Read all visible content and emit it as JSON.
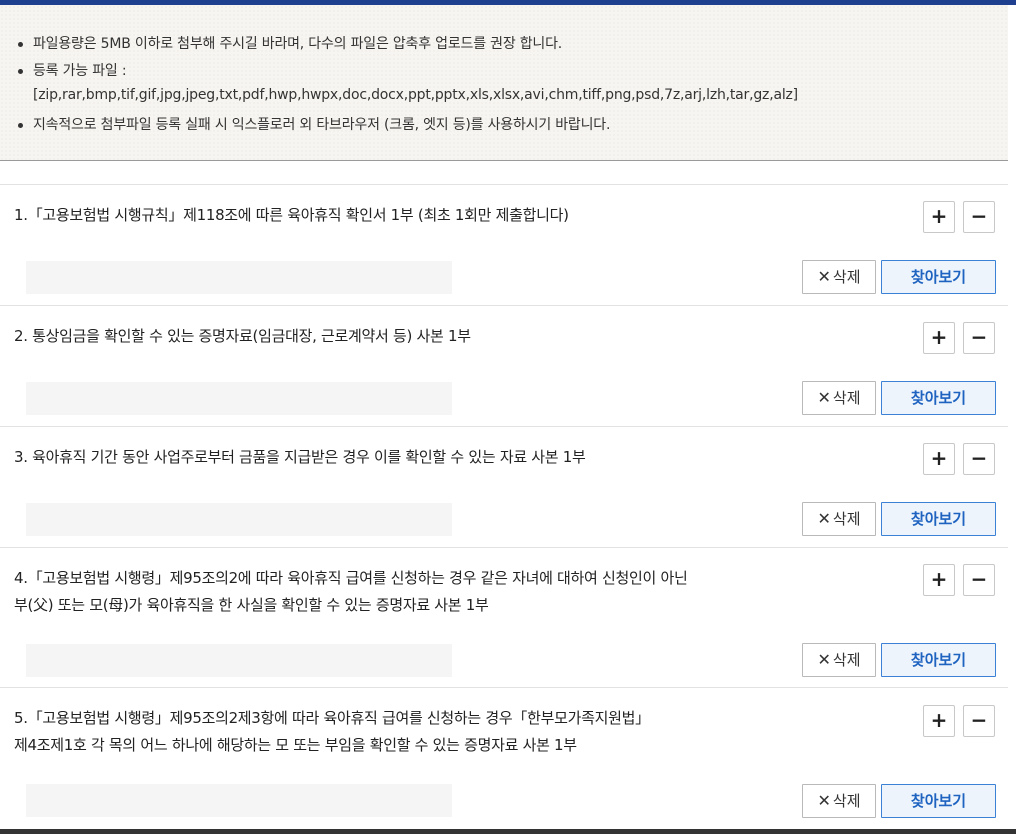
{
  "notice": {
    "line1": "파일용량은 5MB 이하로 첨부해 주시길 바라며, 다수의 파일은 압축후 업로드를 권장 합니다.",
    "line2": "등록 가능 파일 :",
    "line3": "[zip,rar,bmp,tif,gif,jpg,jpeg,txt,pdf,hwp,hwpx,doc,docx,ppt,pptx,xls,xlsx,avi,chm,tiff,png,psd,7z,arj,lzh,tar,gz,alz]",
    "line4": "지속적으로 첨부파일 등록 실패 시 익스플로러 외 타브라우저 (크롬, 엣지 등)를 사용하시기 바랍니다."
  },
  "buttons": {
    "add": "+",
    "remove": "−",
    "delete_x": "✕",
    "delete": "삭제",
    "find": "찾아보기"
  },
  "items": [
    {
      "line1": "1.「고용보험법 시행규칙」제118조에 따른 육아휴직 확인서 1부 (최초 1회만 제출합니다)",
      "line2": ""
    },
    {
      "line1": "2. 통상임금을 확인할 수 있는 증명자료(임금대장, 근로계약서 등) 사본 1부",
      "line2": ""
    },
    {
      "line1": "3. 육아휴직 기간 동안 사업주로부터 금품을 지급받은 경우 이를 확인할 수 있는 자료 사본 1부",
      "line2": ""
    },
    {
      "line1": "4.「고용보험법 시행령」제95조의2에 따라 육아휴직 급여를 신청하는 경우 같은 자녀에 대하여 신청인이 아닌",
      "line2": "부(父) 또는 모(母)가 육아휴직을 한 사실을 확인할 수 있는 증명자료 사본 1부"
    },
    {
      "line1": "5.「고용보험법 시행령」제95조의2제3항에 따라 육아휴직 급여를 신청하는 경우「한부모가족지원법」",
      "line2": "제4조제1호 각 목의 어느 하나에 해당하는 모 또는 부임을 확인할 수 있는 증명자료 사본 1부"
    }
  ]
}
